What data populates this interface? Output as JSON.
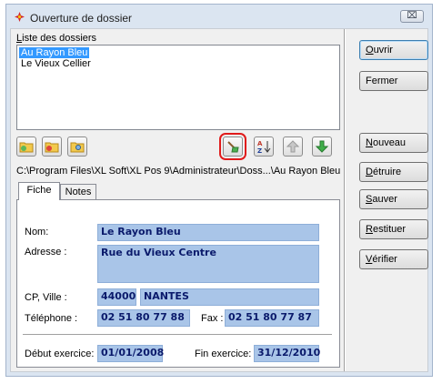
{
  "window": {
    "title": "Ouverture de dossier",
    "close_label": "⌧"
  },
  "list": {
    "label": "Liste des dossiers",
    "items": [
      {
        "label": "Au Rayon Bleu",
        "selected": true
      },
      {
        "label": "Le Vieux Cellier",
        "selected": false
      }
    ]
  },
  "path": "C:\\Program Files\\XL Soft\\XL Pos 9\\Administrateur\\Doss...\\Au Rayon Bleu",
  "tabs": [
    {
      "label": "Fiche"
    },
    {
      "label": "Notes"
    }
  ],
  "fiche": {
    "nom_label": "Nom:",
    "nom": "Le Rayon Bleu",
    "adresse_label": "Adresse :",
    "adresse": "Rue du Vieux Centre",
    "cp_ville_label": "CP, Ville :",
    "cp": "44000",
    "ville": "NANTES",
    "telephone_label": "Téléphone :",
    "telephone": "02 51 80 77 88",
    "fax_label": "Fax :",
    "fax": "02 51 80 77 87",
    "debut_label": "Début exercice:",
    "debut": "01/01/2008",
    "fin_label": "Fin exercice:",
    "fin": "31/12/2010"
  },
  "buttons": {
    "ouvrir": {
      "mnemonic": "O",
      "rest": "uvrir"
    },
    "fermer": {
      "label": "Fermer"
    },
    "nouveau": {
      "mnemonic": "N",
      "rest": "ouveau"
    },
    "detruire": {
      "mnemonic": "D",
      "rest": "étruire"
    },
    "sauver": {
      "mnemonic": "S",
      "rest": "auver"
    },
    "restituer": {
      "mnemonic": "R",
      "rest": "estituer"
    },
    "verifier": {
      "mnemonic": "V",
      "rest": "érifier"
    }
  },
  "icons": {
    "folder_add": "folder-add-icon",
    "folder_remove": "folder-remove-icon",
    "folder_search": "folder-search-icon",
    "broom": "broom-icon",
    "sort_az": "sort-az-icon",
    "arrow_up": "arrow-up-icon",
    "arrow_down": "arrow-down-icon"
  },
  "colors": {
    "selection": "#3399ff",
    "field_bg": "#a9c5e8",
    "field_text": "#0a1a6b",
    "highlight": "#e01b1b"
  }
}
